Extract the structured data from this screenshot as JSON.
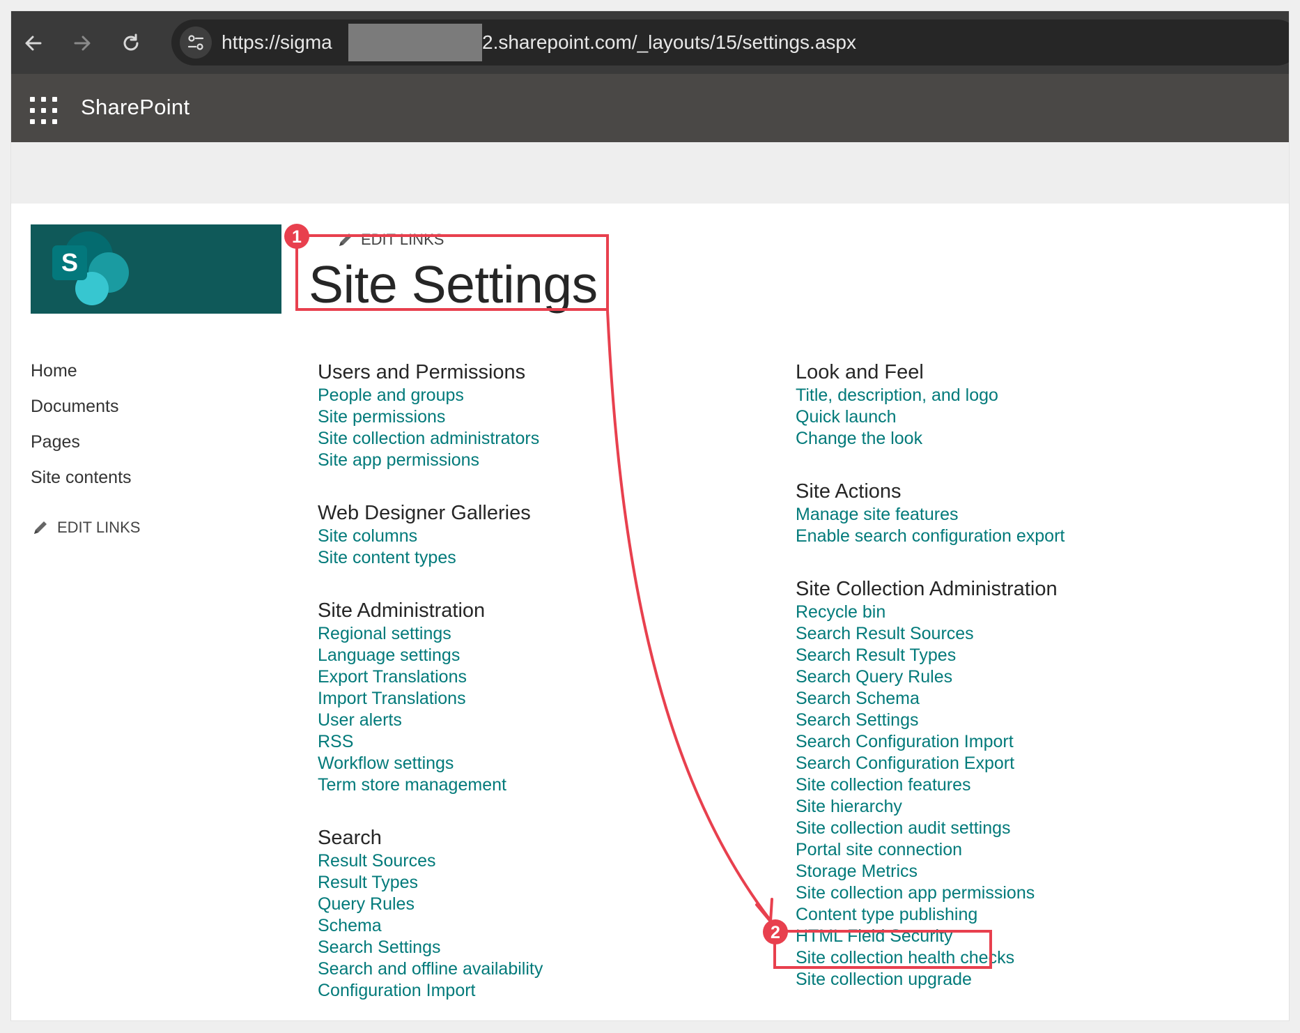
{
  "browser": {
    "url_start": "https://sigma",
    "url_end": "2.sharepoint.com/_layouts/15/settings.aspx"
  },
  "suite": {
    "brand": "SharePoint"
  },
  "page": {
    "edit_links_top": "EDIT LINKS",
    "title": "Site Settings",
    "logo_letter": "S"
  },
  "left_nav": {
    "items": [
      {
        "label": "Home"
      },
      {
        "label": "Documents"
      },
      {
        "label": "Pages"
      },
      {
        "label": "Site contents"
      }
    ],
    "edit_links": "EDIT LINKS"
  },
  "sections_left": [
    {
      "title": "Users and Permissions",
      "links": [
        "People and groups",
        "Site permissions",
        "Site collection administrators",
        "Site app permissions"
      ]
    },
    {
      "title": "Web Designer Galleries",
      "links": [
        "Site columns",
        "Site content types"
      ]
    },
    {
      "title": "Site Administration",
      "links": [
        "Regional settings",
        "Language settings",
        "Export Translations",
        "Import Translations",
        "User alerts",
        "RSS",
        "Workflow settings",
        "Term store management"
      ]
    },
    {
      "title": "Search",
      "links": [
        "Result Sources",
        "Result Types",
        "Query Rules",
        "Schema",
        "Search Settings",
        "Search and offline availability",
        "Configuration Import"
      ]
    }
  ],
  "sections_right": [
    {
      "title": "Look and Feel",
      "links": [
        "Title, description, and logo",
        "Quick launch",
        "Change the look"
      ]
    },
    {
      "title": "Site Actions",
      "links": [
        "Manage site features",
        "Enable search configuration export"
      ]
    },
    {
      "title": "Site Collection Administration",
      "links": [
        "Recycle bin",
        "Search Result Sources",
        "Search Result Types",
        "Search Query Rules",
        "Search Schema",
        "Search Settings",
        "Search Configuration Import",
        "Search Configuration Export",
        "Site collection features",
        "Site hierarchy",
        "Site collection audit settings",
        "Portal site connection",
        "Storage Metrics",
        "Site collection app permissions",
        "Content type publishing",
        "HTML Field Security",
        "Site collection health checks",
        "Site collection upgrade"
      ]
    }
  ],
  "annotations": {
    "step1": "1",
    "step2": "2",
    "color": "#e8404e"
  }
}
